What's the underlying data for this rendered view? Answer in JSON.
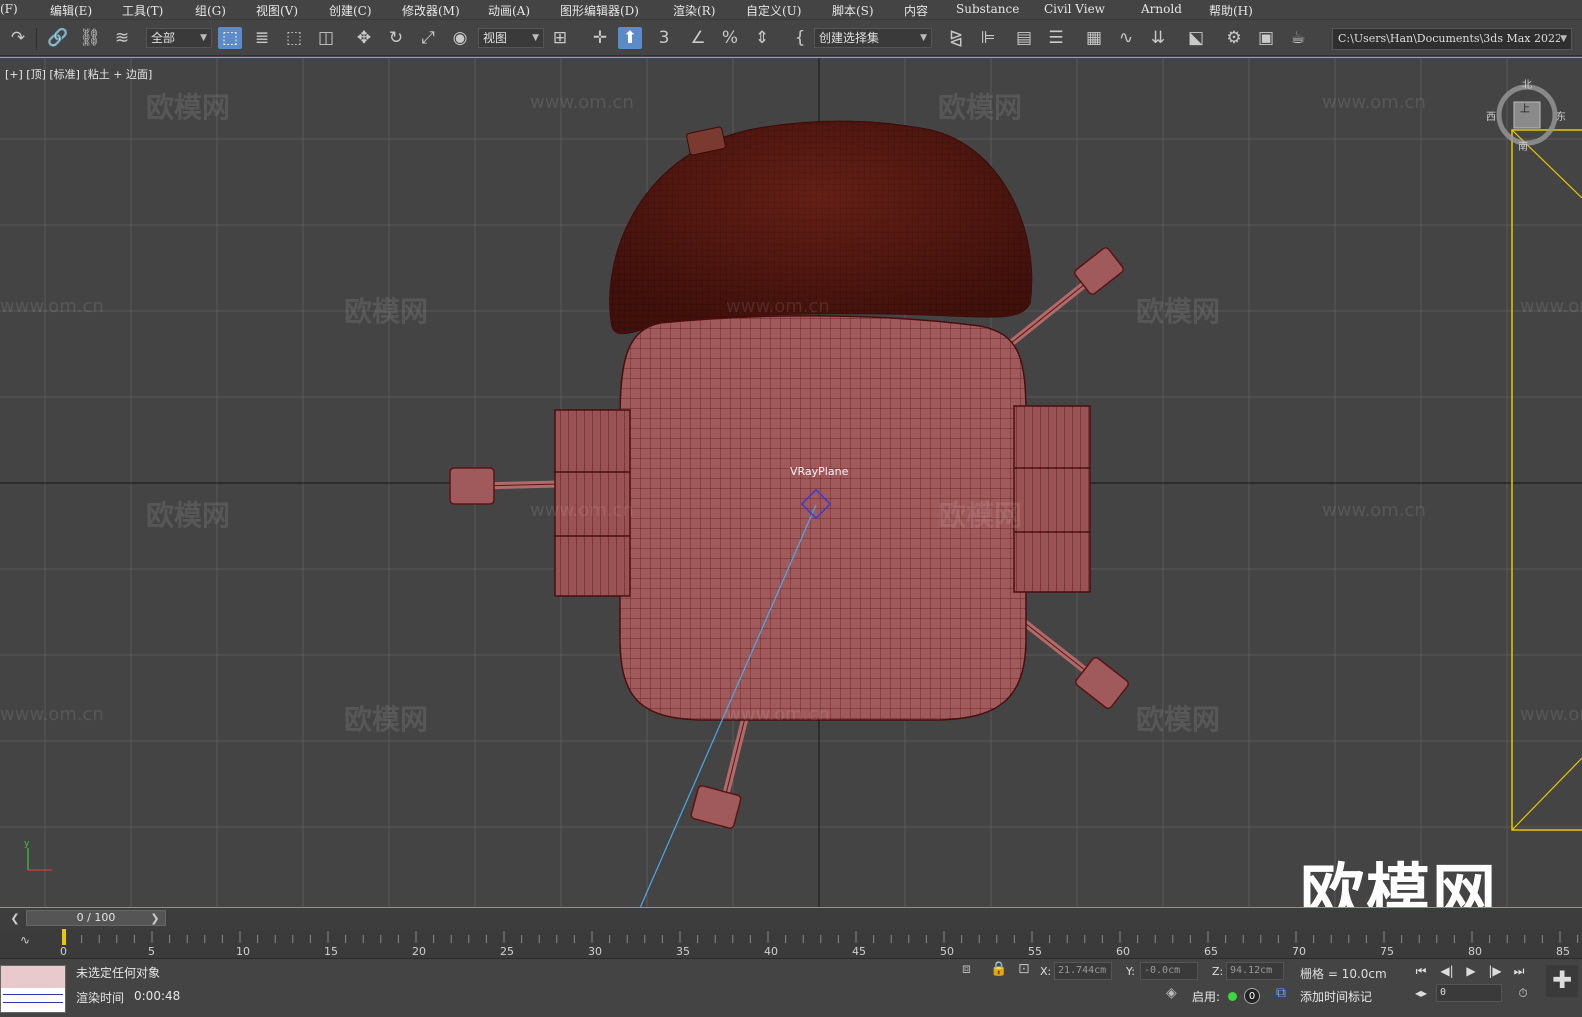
{
  "menu": {
    "items": [
      "(F)",
      "编辑(E)",
      "工具(T)",
      "组(G)",
      "视图(V)",
      "创建(C)",
      "修改器(M)",
      "动画(A)",
      "图形编辑器(D)",
      "渲染(R)",
      "自定义(U)",
      "脚本(S)",
      "内容",
      "Substance",
      "Civil View",
      "Arnold",
      "帮助(H)"
    ]
  },
  "toolbar": {
    "selection_filter": "全部",
    "reference_coord": "视图",
    "named_selection": "创建选择集",
    "project_path": "C:\\Users\\Han\\Documents\\3ds Max 2022"
  },
  "viewport": {
    "label": "[+] [顶] [标准] [粘土 + 边面]",
    "object_label": "VRayPlane",
    "watermark_text": "欧模网",
    "watermark_url": "www.om.cn",
    "big_watermark": "欧模网",
    "viewcube": {
      "north": "北",
      "west": "西",
      "east": "东",
      "south": "南",
      "face": "上"
    },
    "colors": {
      "background": "#444444",
      "grid": "#5a5a5a",
      "axis": "#111111",
      "mesh_fill": "#a0585a",
      "mesh_wire": "#5a1414",
      "selection_line": "#4aa8e8",
      "camera_frame": "#e6c800"
    }
  },
  "time_slider": {
    "frame_display": "0 / 100",
    "prev_icon": "chevron-left-icon",
    "next_icon": "chevron-right-icon"
  },
  "trackbar": {
    "tick_labels": [
      "0",
      "5",
      "10",
      "15",
      "20",
      "25",
      "30",
      "35",
      "40",
      "45",
      "50",
      "55",
      "60",
      "65",
      "70",
      "75",
      "80",
      "85"
    ]
  },
  "status": {
    "selection_message": "未选定任何对象",
    "render_time_label": "渲染时间",
    "render_time_value": "0:00:48",
    "x_label": "X:",
    "x_value": "21.744cm",
    "y_label": "Y:",
    "y_value": "-0.0cm",
    "z_label": "Z:",
    "z_value": "94.12cm",
    "grid_label": "栅格 = 10.0cm",
    "enable_label": "启用:",
    "enable_value": "0",
    "add_time_tag": "添加时间标记",
    "current_frame": "0"
  }
}
